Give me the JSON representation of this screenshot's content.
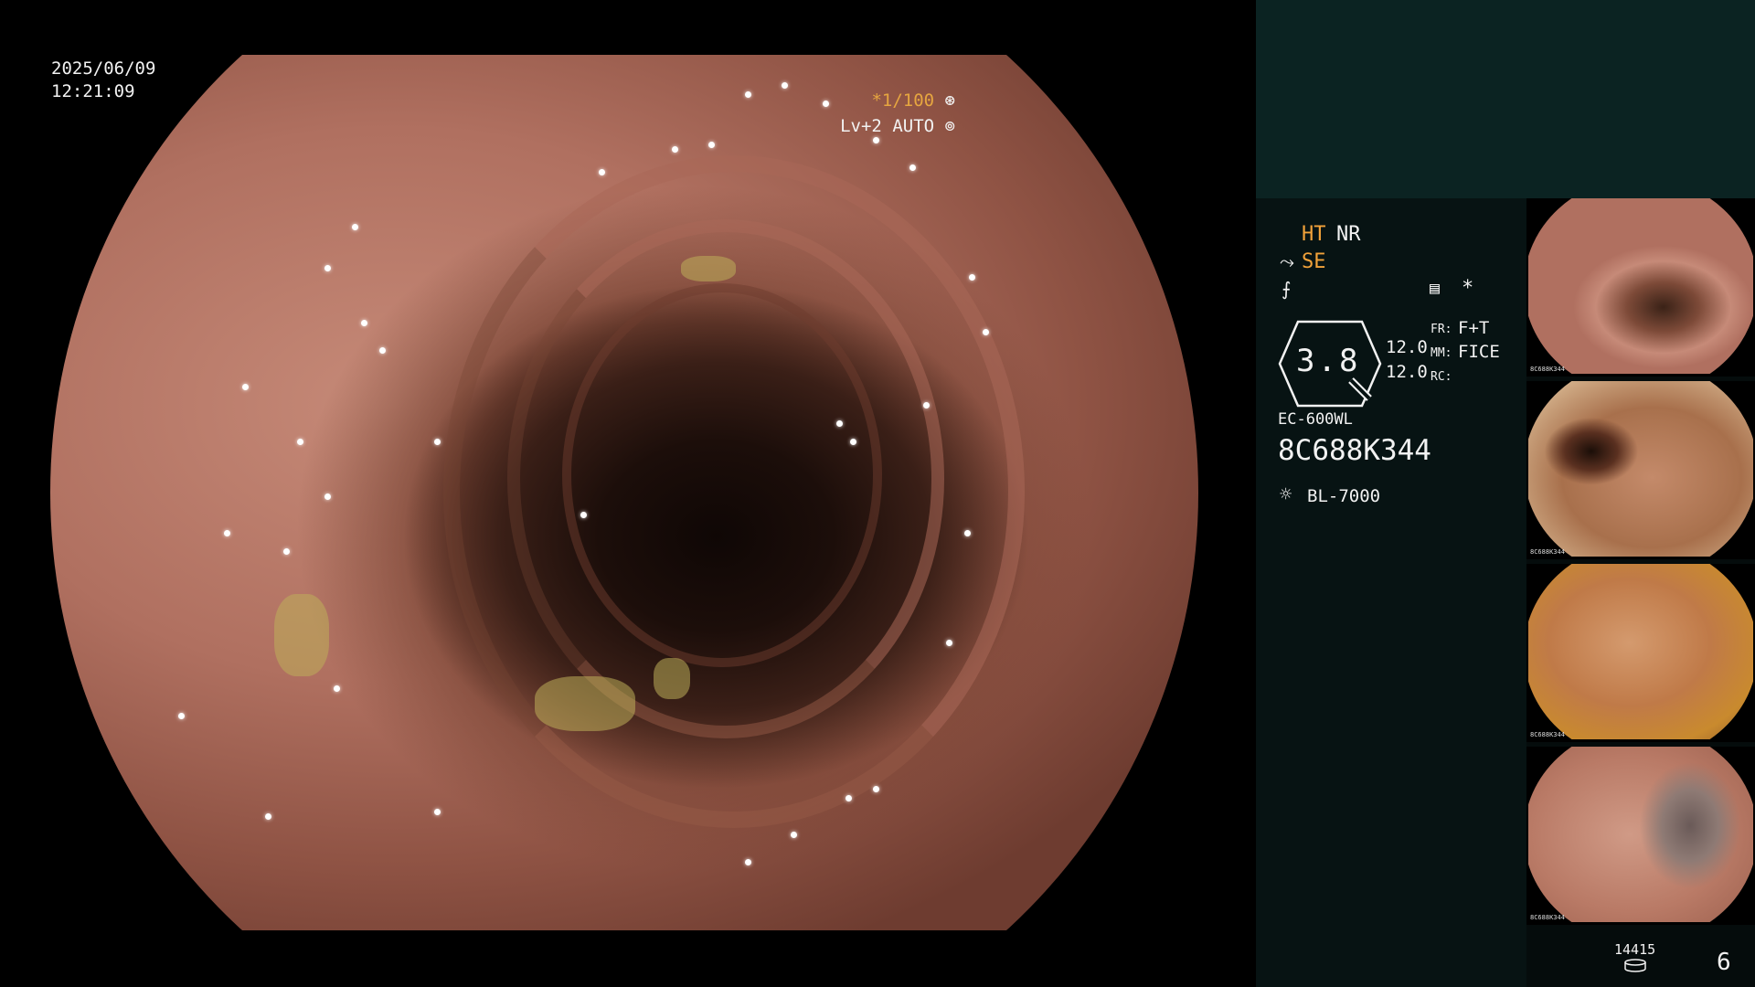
{
  "overlay": {
    "date": "2025/06/09",
    "time": "12:21:09",
    "shutter_mark": "*",
    "shutter": "1/100",
    "light_level": "Lv+2",
    "iris_mode": "AUTO"
  },
  "panel": {
    "ht": "HT",
    "nr": "NR",
    "se": "SE",
    "star": "*",
    "zoom_value": "3.8",
    "values": [
      "12.0",
      "12.0"
    ],
    "fr_label": "FR:",
    "fr_value": "F+T",
    "mm_label": "MM:",
    "mm_value": "FICE",
    "rc_label": "RC:",
    "scope_model": "EC-600WL",
    "scope_serial": "8C688K344",
    "light_source": "BL-7000",
    "image_count": "14415",
    "page_number": "6"
  },
  "thumbnails": [
    {
      "caption": "8C688K344"
    },
    {
      "caption": "8C688K344"
    },
    {
      "caption": "8C688K344"
    },
    {
      "caption": "8C688K344"
    }
  ],
  "colors": {
    "panel_top": "#0b2322",
    "accent_orange": "#f2a23a"
  }
}
